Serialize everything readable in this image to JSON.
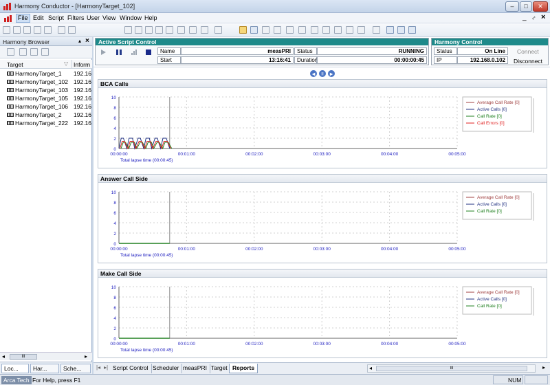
{
  "window": {
    "title": "Harmony Conductor - [HarmonyTarget_102]",
    "min": "–",
    "max": "□",
    "close": "✕"
  },
  "menu": [
    "File",
    "Edit",
    "Script",
    "Filters",
    "User",
    "View",
    "Window",
    "Help"
  ],
  "mdi_controls": {
    "min": "_",
    "restore": "♂",
    "close": "×"
  },
  "left_panel": {
    "title": "Harmony Browser",
    "pin": "▴",
    "close": "×",
    "columns": {
      "target": "Target",
      "info": "Inform"
    },
    "targets": [
      {
        "name": "HarmonyTarget_1",
        "ip": "192.16"
      },
      {
        "name": "HarmonyTarget_102",
        "ip": "192.16"
      },
      {
        "name": "HarmonyTarget_103",
        "ip": "192.16"
      },
      {
        "name": "HarmonyTarget_105",
        "ip": "192.16"
      },
      {
        "name": "HarmonyTarget_106",
        "ip": "192.16"
      },
      {
        "name": "HarmonyTarget_2",
        "ip": "192.16"
      },
      {
        "name": "HarmonyTarget_222",
        "ip": "192.16"
      }
    ],
    "scroll_thumb": "III",
    "tabs": [
      "Loc...",
      "Har...",
      "Sche..."
    ]
  },
  "script_control": {
    "title": "Active Script Control",
    "name_label": "Name",
    "name_value": "measPRI",
    "status_label": "Status",
    "status_value": "RUNNING",
    "start_label": "Start",
    "start_value": "13:16:41",
    "duration_label": "Duration",
    "duration_value": "00:00:00:45"
  },
  "harmony_control": {
    "title": "Harmony Control",
    "status_label": "Status",
    "status_value": "On Line",
    "ip_label": "IP",
    "ip_value": "192.168.0.102",
    "connect": "Connect",
    "disconnect": "Disconnect"
  },
  "colors": {
    "teal": "#1e8a8a",
    "avg": "#a04040",
    "active": "#203080",
    "rate": "#208020",
    "errors": "#e02020",
    "axis": "#2020c0"
  },
  "charts": [
    {
      "title": "BCA Calls",
      "legend": [
        "Average Call Rate [0]",
        "Active Calls [0]",
        "Call Rate [0]",
        "Call Errors [0]"
      ],
      "lapse": "Total lapse time (00:00:45)",
      "show_pulses": true
    },
    {
      "title": "Answer Call Side",
      "legend": [
        "Average Call Rate [0]",
        "Active Calls [0]",
        "Call Rate [0]"
      ],
      "lapse": "Total lapse time (00:00:45)",
      "show_pulses": false
    },
    {
      "title": "Make Call Side",
      "legend": [
        "Average Call Rate [0]",
        "Active Calls [0]",
        "Call Rate [0]"
      ],
      "lapse": "Total lapse time (00:00:45)",
      "show_pulses": false
    }
  ],
  "chart_data": [
    {
      "type": "line",
      "title": "BCA Calls",
      "x_ticks": [
        "00:00:00",
        "00:01:00",
        "00:02:00",
        "00:03:00",
        "00:04:00",
        "00:05:00"
      ],
      "y_ticks": [
        0,
        2,
        4,
        6,
        8,
        10
      ],
      "ylim": [
        0,
        10
      ],
      "series": [
        {
          "name": "Average Call Rate [0]",
          "values": []
        },
        {
          "name": "Active Calls [0]",
          "x": [
            "00:00:00",
            "00:00:02",
            "00:00:04",
            "00:00:07",
            "00:00:09",
            "00:00:12",
            "00:00:14",
            "00:00:17",
            "00:00:19",
            "00:00:22",
            "00:00:24",
            "00:00:27",
            "00:00:29",
            "00:00:32",
            "00:00:34",
            "00:00:37",
            "00:00:39",
            "00:00:42",
            "00:00:45"
          ],
          "values": [
            0,
            2,
            2,
            0,
            2,
            2,
            0,
            2,
            2,
            0,
            2,
            2,
            0,
            2,
            2,
            0,
            2,
            2,
            0
          ]
        },
        {
          "name": "Call Rate [0]",
          "values": []
        },
        {
          "name": "Call Errors [0]",
          "values": []
        }
      ]
    },
    {
      "type": "line",
      "title": "Answer Call Side",
      "x_ticks": [
        "00:00:00",
        "00:01:00",
        "00:02:00",
        "00:03:00",
        "00:04:00",
        "00:05:00"
      ],
      "y_ticks": [
        0,
        2,
        4,
        6,
        8,
        10
      ],
      "ylim": [
        0,
        10
      ],
      "series": [
        {
          "name": "Average Call Rate [0]",
          "values": [
            0
          ]
        },
        {
          "name": "Active Calls [0]",
          "values": [
            0
          ]
        },
        {
          "name": "Call Rate [0]",
          "values": [
            0
          ]
        }
      ]
    },
    {
      "type": "line",
      "title": "Make Call Side",
      "x_ticks": [
        "00:00:00",
        "00:01:00",
        "00:02:00",
        "00:03:00",
        "00:04:00",
        "00:05:00"
      ],
      "y_ticks": [
        0,
        2,
        4,
        6,
        8,
        10
      ],
      "ylim": [
        0,
        10
      ],
      "series": [
        {
          "name": "Average Call Rate [0]",
          "values": [
            0
          ]
        },
        {
          "name": "Active Calls [0]",
          "values": [
            0
          ]
        },
        {
          "name": "Call Rate [0]",
          "values": [
            0
          ]
        }
      ]
    }
  ],
  "bottom_tabs": [
    "Script Control",
    "Scheduler",
    "measPRI",
    "Target",
    "Reports"
  ],
  "bottom_active": "Reports",
  "hscroll_thumb": "III",
  "status": {
    "company": "Arca Tech",
    "help": "For Help, press F1",
    "num": "NUM"
  }
}
